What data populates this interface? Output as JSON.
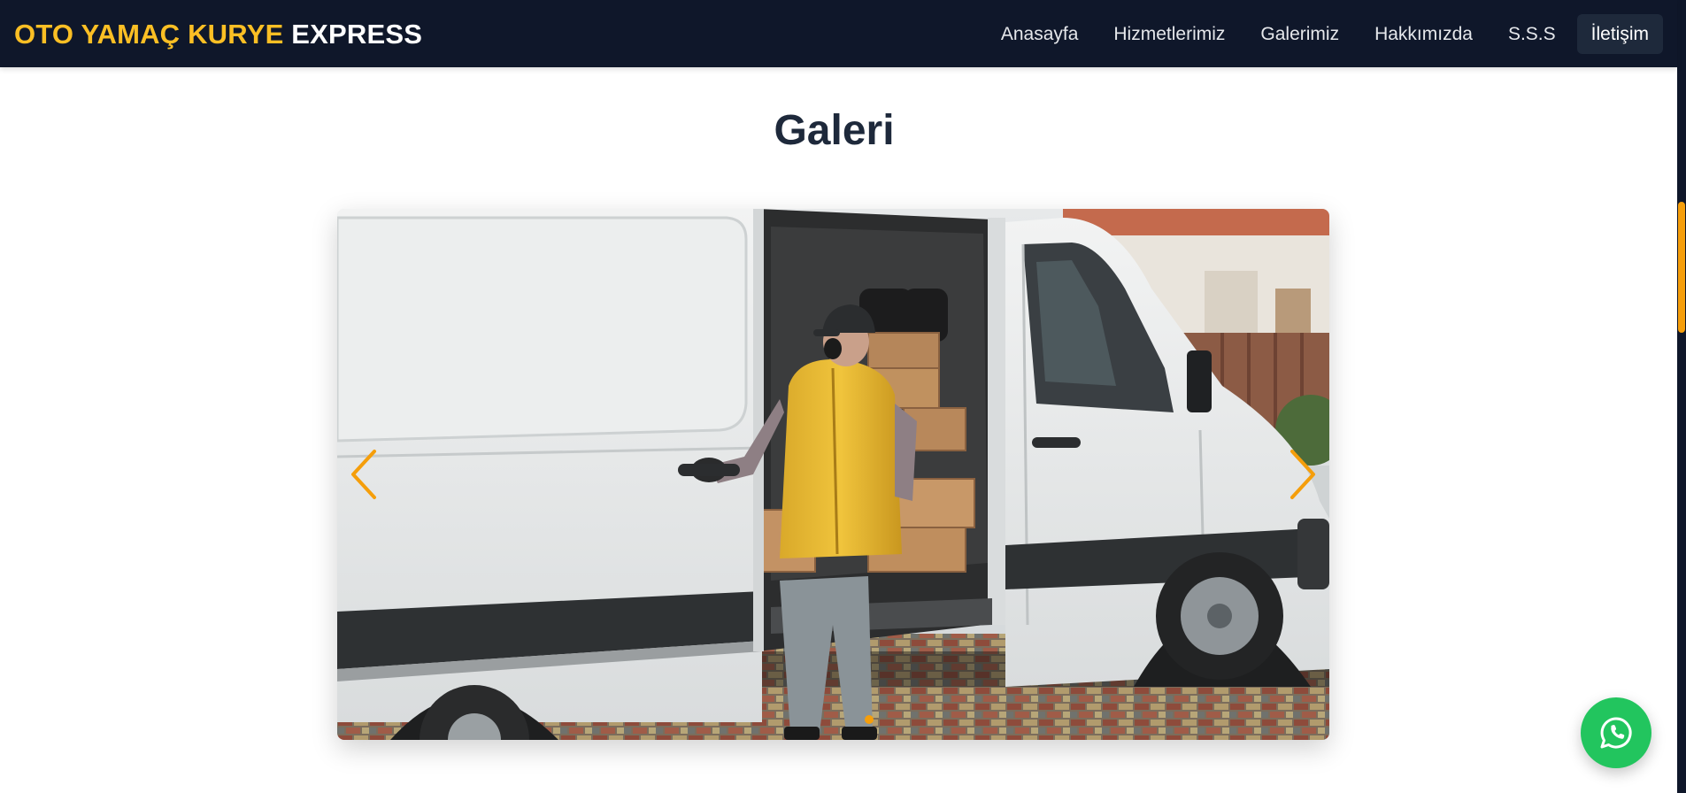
{
  "header": {
    "brand_accent": "OTO YAMAÇ KURYE",
    "brand_main": "EXPRESS",
    "nav": [
      {
        "label": "Anasayfa"
      },
      {
        "label": "Hizmetlerimiz"
      },
      {
        "label": "Galerimiz"
      },
      {
        "label": "Hakkımızda"
      },
      {
        "label": "S.S.S"
      },
      {
        "label": "İletişim"
      }
    ],
    "active_item": "İletişim"
  },
  "gallery": {
    "title": "Galeri",
    "slide": {
      "description_icon": "van-photo-image",
      "current_index": 1,
      "total_slides": 1
    },
    "prev_icon": "chevron-left-icon",
    "next_icon": "chevron-right-icon"
  },
  "whatsapp": {
    "icon": "whatsapp-icon"
  },
  "colors": {
    "navbar_bg": "#0f172a",
    "brand_accent": "#fbbf24",
    "accent": "#f59e0b",
    "whatsapp": "#22c55e",
    "title": "#1e293b"
  }
}
